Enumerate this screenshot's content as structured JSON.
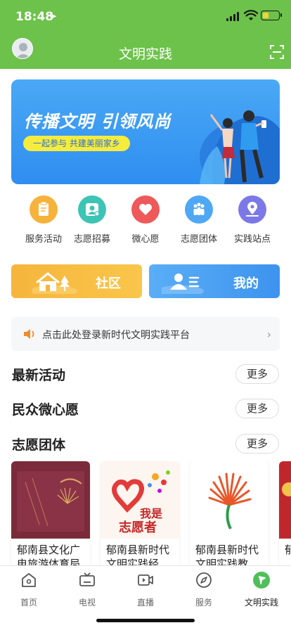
{
  "status_bar": {
    "time": "18:48",
    "location_icon": "location-arrow-icon"
  },
  "header": {
    "title": "文明实践",
    "avatar_icon": "user-avatar-icon",
    "scan_icon": "scan-icon"
  },
  "banner": {
    "title": "传播文明 引领风尚",
    "subtitle": "一起参与 共建美丽家乡"
  },
  "quick_links": [
    {
      "label": "服务活动",
      "icon": "service-activity-icon",
      "color": "#f6b23a"
    },
    {
      "label": "志愿招募",
      "icon": "volunteer-recruit-icon",
      "color": "#3cc4b4"
    },
    {
      "label": "微心愿",
      "icon": "heart-icon",
      "color": "#ee5a5a"
    },
    {
      "label": "志愿团体",
      "icon": "volunteer-group-icon",
      "color": "#4fa8f4"
    },
    {
      "label": "实践站点",
      "icon": "site-location-icon",
      "color": "#7b79e8"
    }
  ],
  "big_buttons": {
    "community": "社区",
    "mine": "我的"
  },
  "notice": {
    "text": "点击此处登录新时代文明实践平台"
  },
  "sections": [
    {
      "title": "最新活动",
      "more": "更多"
    },
    {
      "title": "民众微心愿",
      "more": "更多"
    },
    {
      "title": "志愿团体",
      "more": "更多"
    }
  ],
  "cards": [
    {
      "title": "郁南县文化广电旅游体育局"
    },
    {
      "title": "郁南县新时代文明实践经"
    },
    {
      "title": "郁南县新时代文明实践教"
    },
    {
      "title": "郁"
    }
  ],
  "card_images": {
    "card2_line1": "我是",
    "card2_line2": "志愿者"
  },
  "tabbar": [
    {
      "label": "首页",
      "icon": "home-icon"
    },
    {
      "label": "电视",
      "icon": "tv-icon"
    },
    {
      "label": "直播",
      "icon": "live-video-icon"
    },
    {
      "label": "服务",
      "icon": "compass-icon"
    },
    {
      "label": "文明实践",
      "icon": "flag-icon",
      "active": true
    }
  ],
  "colors": {
    "brand_green": "#6cc24a",
    "banner_blue": "#3a9bf2",
    "accent_yellow": "#f7ec3d"
  }
}
